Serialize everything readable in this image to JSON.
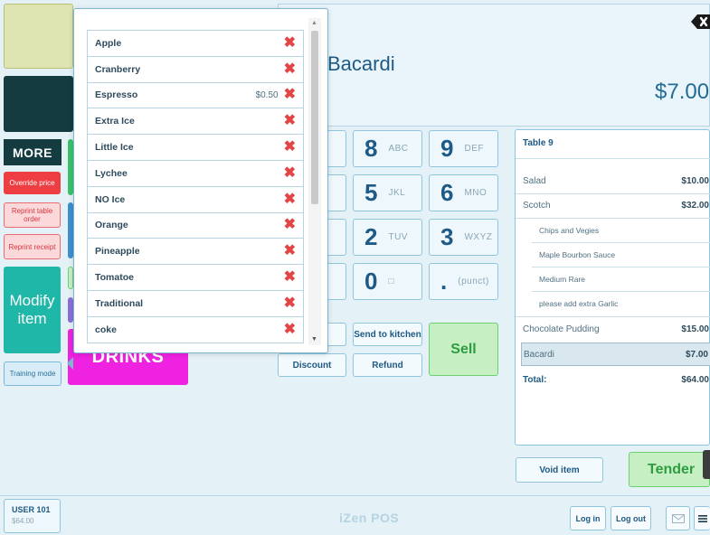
{
  "left_panel": {
    "more_label": "MORE",
    "override_price_label": "Override price",
    "reprint_table_label": "Reprint table order",
    "reprint_receipt_label": "Reprint receipt",
    "modify_label": "Modify item",
    "drinks_label": "DRINKS",
    "training_label": "Training mode"
  },
  "item": {
    "name": "Bacardi",
    "price": "$7.00"
  },
  "keypad": [
    {
      "digit": "8",
      "letters": "ABC"
    },
    {
      "digit": "9",
      "letters": "DEF"
    },
    {
      "digit": "5",
      "letters": "JKL"
    },
    {
      "digit": "6",
      "letters": "MNO"
    },
    {
      "digit": "2",
      "letters": "TUV"
    },
    {
      "digit": "3",
      "letters": "WXYZ"
    },
    {
      "digit": "0",
      "letters": "□"
    },
    {
      "digit": ".",
      "letters": "(punct)"
    }
  ],
  "actions": {
    "send_to_kitchen": "Send to kitchen",
    "sell": "Sell",
    "discount": "Discount",
    "refund": "Refund",
    "void_item": "Void item",
    "tender": "Tender"
  },
  "order": {
    "title": "Table 9",
    "lines": [
      {
        "name": "Salad",
        "amount": "$10.00"
      },
      {
        "name": "Scotch",
        "amount": "$32.00"
      },
      {
        "name": "Chips and Vegies",
        "amount": ""
      },
      {
        "name": "Maple Bourbon Sauce",
        "amount": ""
      },
      {
        "name": "Medium Rare",
        "amount": ""
      },
      {
        "name": "please add extra Garlic",
        "amount": ""
      },
      {
        "name": "Chocolate Pudding",
        "amount": "$15.00"
      },
      {
        "name": "Bacardi",
        "amount": "$7.00"
      }
    ],
    "total_label": "Total:",
    "total_amount": "$64.00"
  },
  "footer": {
    "user_name": "USER 101",
    "user_amount": "$64.00",
    "brand": "iZen POS",
    "login": "Log in",
    "logout": "Log out"
  },
  "popup": {
    "items": [
      {
        "label": "Apple",
        "charge": ""
      },
      {
        "label": "Cranberry",
        "charge": ""
      },
      {
        "label": "Espresso",
        "charge": "$0.50"
      },
      {
        "label": "Extra Ice",
        "charge": ""
      },
      {
        "label": "Little Ice",
        "charge": ""
      },
      {
        "label": "Lychee",
        "charge": ""
      },
      {
        "label": "NO Ice",
        "charge": ""
      },
      {
        "label": "Orange",
        "charge": ""
      },
      {
        "label": "Pineapple",
        "charge": ""
      },
      {
        "label": "Tomatoe",
        "charge": ""
      },
      {
        "label": "Traditional",
        "charge": ""
      },
      {
        "label": "coke",
        "charge": ""
      }
    ],
    "remove_icon": "close-icon"
  },
  "colors": {
    "accent": "#1fb8a8",
    "dark_teal": "#143c40",
    "alert_red": "#ee3e42",
    "sell_green": "#c6f0c4",
    "drinks_magenta": "#ee22e0"
  }
}
